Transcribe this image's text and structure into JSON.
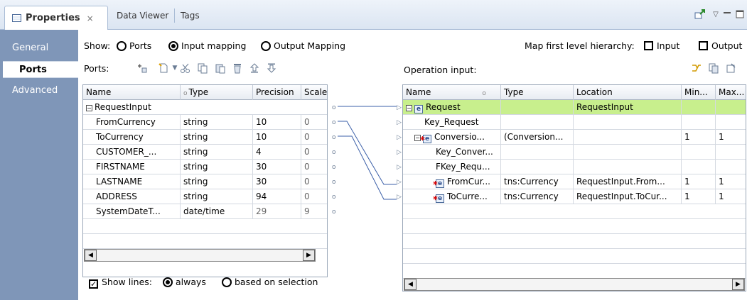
{
  "tabs": [
    {
      "label": "Properties",
      "close": "×"
    },
    {
      "label": "Data Viewer"
    },
    {
      "label": "Tags"
    }
  ],
  "sidebar": {
    "items": [
      "General",
      "Ports",
      "Advanced"
    ]
  },
  "show": {
    "label": "Show:",
    "options": [
      "Ports",
      "Input mapping",
      "Output Mapping"
    ],
    "selected": "Input mapping"
  },
  "map_hierarchy": {
    "label": "Map first level hierarchy:",
    "input": "Input",
    "output": "Output"
  },
  "ports_label": "Ports:",
  "operation_input_label": "Operation input:",
  "ports_table": {
    "columns": [
      "Name",
      "Type",
      "Precision",
      "Scale"
    ],
    "rows": [
      {
        "name": "RequestInput",
        "type": "",
        "precision": "",
        "scale": ""
      },
      {
        "name": "FromCurrency",
        "type": "string",
        "precision": "10",
        "scale": "0"
      },
      {
        "name": "ToCurrency",
        "type": "string",
        "precision": "10",
        "scale": "0"
      },
      {
        "name": "CUSTOMER_...",
        "type": "string",
        "precision": "4",
        "scale": "0"
      },
      {
        "name": "FIRSTNAME",
        "type": "string",
        "precision": "30",
        "scale": "0"
      },
      {
        "name": "LASTNAME",
        "type": "string",
        "precision": "30",
        "scale": "0"
      },
      {
        "name": "ADDRESS",
        "type": "string",
        "precision": "94",
        "scale": "0"
      },
      {
        "name": "SystemDateT...",
        "type": "date/time",
        "precision": "29",
        "scale": "9"
      }
    ]
  },
  "operation_table": {
    "columns": [
      "Name",
      "Type",
      "Location",
      "Min...",
      "Max..."
    ],
    "rows": [
      {
        "name": "Request",
        "type": "",
        "location": "RequestInput",
        "min": "",
        "max": ""
      },
      {
        "name": "Key_Request",
        "type": "",
        "location": "",
        "min": "",
        "max": ""
      },
      {
        "name": "Conversio...",
        "type": "(Conversion...",
        "location": "",
        "min": "1",
        "max": "1"
      },
      {
        "name": "Key_Conver...",
        "type": "",
        "location": "",
        "min": "",
        "max": ""
      },
      {
        "name": "FKey_Requ...",
        "type": "",
        "location": "",
        "min": "",
        "max": ""
      },
      {
        "name": "FromCur...",
        "type": "tns:Currency",
        "location": "RequestInput.From...",
        "min": "1",
        "max": "1"
      },
      {
        "name": "ToCurre...",
        "type": "tns:Currency",
        "location": "RequestInput.ToCur...",
        "min": "1",
        "max": "1"
      }
    ]
  },
  "show_lines": {
    "label": "Show lines:",
    "options": [
      "always",
      "based on selection"
    ],
    "selected": "always"
  },
  "colors": {
    "sidebar": "#7f96b8",
    "selected_row": "#c8ef8d",
    "line": "#3b5fa8"
  }
}
